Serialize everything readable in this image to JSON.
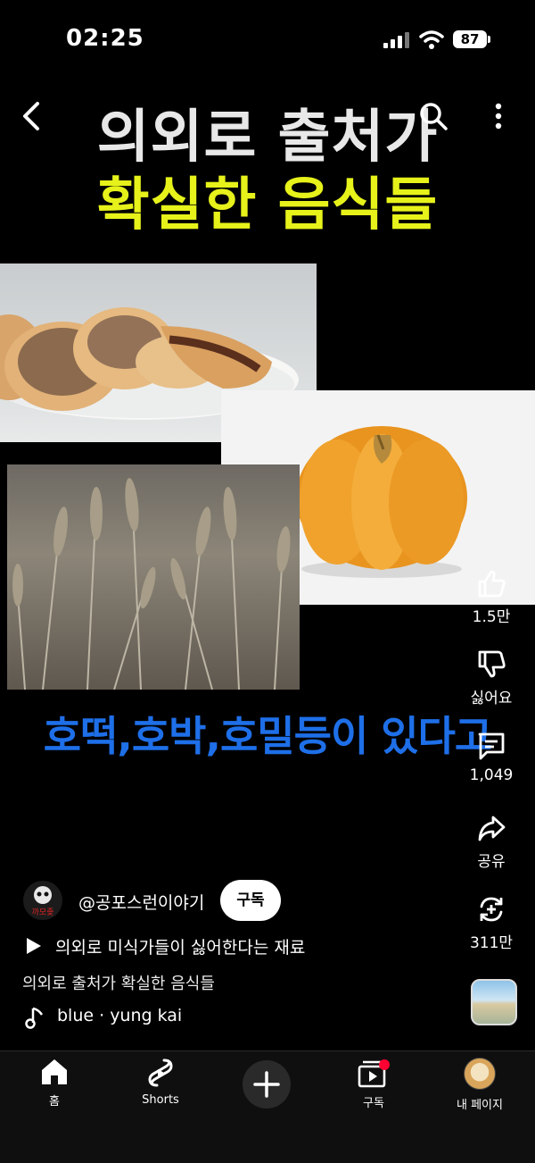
{
  "status": {
    "time": "02:25",
    "battery": "87"
  },
  "headline": {
    "line1": "의외로 출처가",
    "line2": "확실한 음식들"
  },
  "subtitle": "호떡,호박,호밀등이 있다고",
  "actions": {
    "like_count": "1.5만",
    "dislike_label": "싫어요",
    "comment_count": "1,049",
    "share_label": "공유",
    "remix_count": "311만"
  },
  "channel": {
    "name": "@공포스런이야기",
    "subscribe_label": "구독",
    "avatar_text": "까모좆"
  },
  "related_video": "의외로 미식가들이 싫어한다는 재료",
  "description": "의외로 출처가 확실한 음식들",
  "music": "blue · yung kai",
  "nav": {
    "home": "홈",
    "shorts": "Shorts",
    "subscriptions": "구독",
    "me": "내 페이지"
  },
  "colors": {
    "headline_accent": "#e6f21a",
    "subtitle": "#1e6fe8",
    "notification_dot": "#ff0033"
  },
  "icons": [
    "back-icon",
    "search-icon",
    "more-icon",
    "like-icon",
    "dislike-icon",
    "comment-icon",
    "share-icon",
    "remix-icon",
    "play-icon",
    "music-note-icon",
    "home-icon",
    "shorts-icon",
    "plus-icon",
    "subscriptions-icon"
  ]
}
